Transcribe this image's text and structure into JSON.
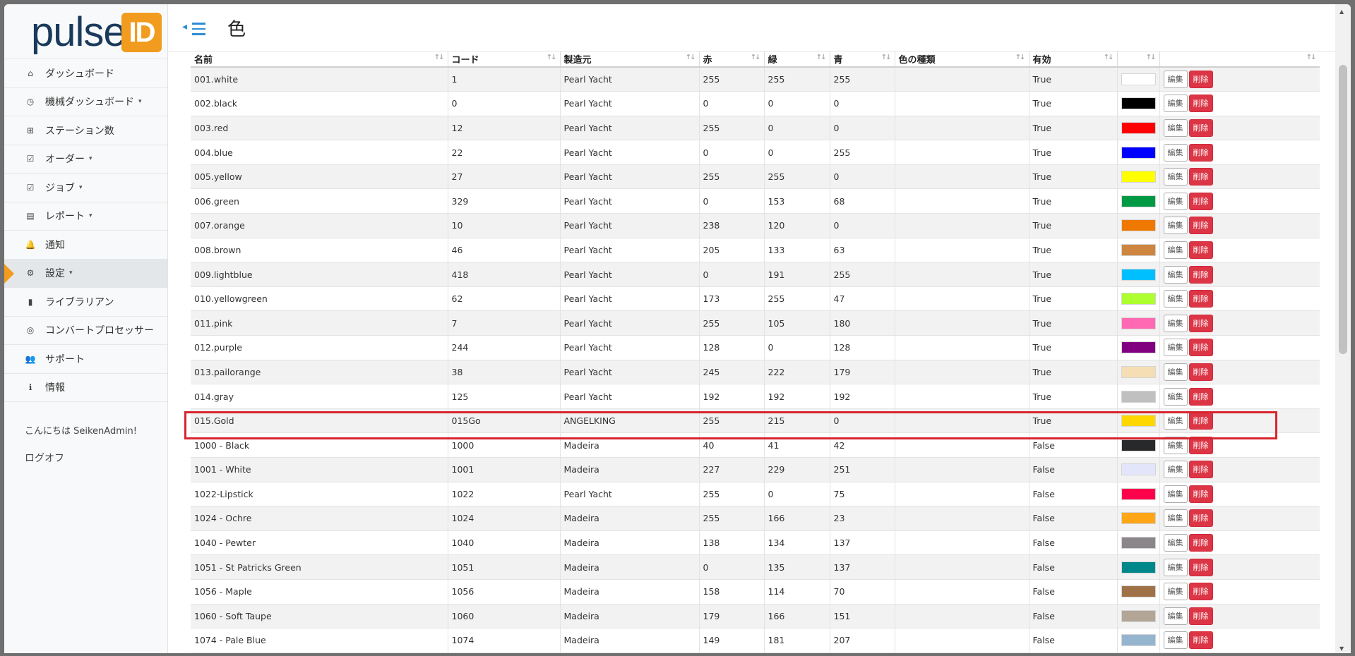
{
  "logo": {
    "text": "pulse",
    "badge": "ID"
  },
  "page": {
    "title": "色"
  },
  "sidebar": {
    "items": [
      {
        "label": "ダッシュボード",
        "icon": "home-icon",
        "glyph": "⌂",
        "caret": ""
      },
      {
        "label": "機械ダッシュボード",
        "icon": "dashboard-icon",
        "glyph": "◷",
        "caret": "▾"
      },
      {
        "label": "ステーション数",
        "icon": "station-icon",
        "glyph": "⊞",
        "caret": ""
      },
      {
        "label": "オーダー",
        "icon": "checkbox-icon",
        "glyph": "☑",
        "caret": "▾"
      },
      {
        "label": "ジョブ",
        "icon": "checkbox-icon",
        "glyph": "☑",
        "caret": "▾"
      },
      {
        "label": "レポート",
        "icon": "report-icon",
        "glyph": "▤",
        "caret": "▾"
      },
      {
        "label": "通知",
        "icon": "bell-icon",
        "glyph": "🔔",
        "caret": ""
      },
      {
        "label": "設定",
        "icon": "gear-icon",
        "glyph": "⚙",
        "caret": "▾"
      },
      {
        "label": "ライブラリアン",
        "icon": "book-icon",
        "glyph": "▮",
        "caret": ""
      },
      {
        "label": "コンバートプロセッサー",
        "icon": "target-icon",
        "glyph": "◎",
        "caret": ""
      },
      {
        "label": "サポート",
        "icon": "users-icon",
        "glyph": "👥",
        "caret": ""
      },
      {
        "label": "情報",
        "icon": "info-icon",
        "glyph": "ℹ",
        "caret": ""
      }
    ],
    "active_index": 7,
    "greeting": "こんにちは SeikenAdmin!",
    "logoff": "ログオフ"
  },
  "table": {
    "headers": [
      "名前",
      "コード",
      "製造元",
      "赤",
      "緑",
      "青",
      "色の種類",
      "有効",
      "",
      ""
    ],
    "sort_icons": [
      "↑↓",
      "↑↓",
      "↑↓",
      "↑↓",
      "↑↓",
      "↑↓",
      "↑↓",
      "↑↓",
      "↑↓",
      "↑↓"
    ],
    "edit_label": "編集",
    "delete_label": "削除",
    "highlighted_row": 14,
    "rows": [
      {
        "name": "001.white",
        "code": "1",
        "maker": "Pearl Yacht",
        "r": "255",
        "g": "255",
        "b": "255",
        "type": "",
        "active": "True",
        "color": "#ffffff"
      },
      {
        "name": "002.black",
        "code": "0",
        "maker": "Pearl Yacht",
        "r": "0",
        "g": "0",
        "b": "0",
        "type": "",
        "active": "True",
        "color": "#000000"
      },
      {
        "name": "003.red",
        "code": "12",
        "maker": "Pearl Yacht",
        "r": "255",
        "g": "0",
        "b": "0",
        "type": "",
        "active": "True",
        "color": "#ff0000"
      },
      {
        "name": "004.blue",
        "code": "22",
        "maker": "Pearl Yacht",
        "r": "0",
        "g": "0",
        "b": "255",
        "type": "",
        "active": "True",
        "color": "#0000ff"
      },
      {
        "name": "005.yellow",
        "code": "27",
        "maker": "Pearl Yacht",
        "r": "255",
        "g": "255",
        "b": "0",
        "type": "",
        "active": "True",
        "color": "#ffff00"
      },
      {
        "name": "006.green",
        "code": "329",
        "maker": "Pearl Yacht",
        "r": "0",
        "g": "153",
        "b": "68",
        "type": "",
        "active": "True",
        "color": "#009944"
      },
      {
        "name": "007.orange",
        "code": "10",
        "maker": "Pearl Yacht",
        "r": "238",
        "g": "120",
        "b": "0",
        "type": "",
        "active": "True",
        "color": "#ee7800"
      },
      {
        "name": "008.brown",
        "code": "46",
        "maker": "Pearl Yacht",
        "r": "205",
        "g": "133",
        "b": "63",
        "type": "",
        "active": "True",
        "color": "#cd853f"
      },
      {
        "name": "009.lightblue",
        "code": "418",
        "maker": "Pearl Yacht",
        "r": "0",
        "g": "191",
        "b": "255",
        "type": "",
        "active": "True",
        "color": "#00bfff"
      },
      {
        "name": "010.yellowgreen",
        "code": "62",
        "maker": "Pearl Yacht",
        "r": "173",
        "g": "255",
        "b": "47",
        "type": "",
        "active": "True",
        "color": "#adff2f"
      },
      {
        "name": "011.pink",
        "code": "7",
        "maker": "Pearl Yacht",
        "r": "255",
        "g": "105",
        "b": "180",
        "type": "",
        "active": "True",
        "color": "#ff69b4"
      },
      {
        "name": "012.purple",
        "code": "244",
        "maker": "Pearl Yacht",
        "r": "128",
        "g": "0",
        "b": "128",
        "type": "",
        "active": "True",
        "color": "#800080"
      },
      {
        "name": "013.pailorange",
        "code": "38",
        "maker": "Pearl Yacht",
        "r": "245",
        "g": "222",
        "b": "179",
        "type": "",
        "active": "True",
        "color": "#f5deb3"
      },
      {
        "name": "014.gray",
        "code": "125",
        "maker": "Pearl Yacht",
        "r": "192",
        "g": "192",
        "b": "192",
        "type": "",
        "active": "True",
        "color": "#c0c0c0"
      },
      {
        "name": "015.Gold",
        "code": "015Go",
        "maker": "ANGELKING",
        "r": "255",
        "g": "215",
        "b": "0",
        "type": "",
        "active": "True",
        "color": "#ffd700"
      },
      {
        "name": "1000 - Black",
        "code": "1000",
        "maker": "Madeira",
        "r": "40",
        "g": "41",
        "b": "42",
        "type": "",
        "active": "False",
        "color": "#28292a"
      },
      {
        "name": "1001 - White",
        "code": "1001",
        "maker": "Madeira",
        "r": "227",
        "g": "229",
        "b": "251",
        "type": "",
        "active": "False",
        "color": "#e3e5fb"
      },
      {
        "name": "1022-Lipstick",
        "code": "1022",
        "maker": "Pearl Yacht",
        "r": "255",
        "g": "0",
        "b": "75",
        "type": "",
        "active": "False",
        "color": "#ff004b"
      },
      {
        "name": "1024 - Ochre",
        "code": "1024",
        "maker": "Madeira",
        "r": "255",
        "g": "166",
        "b": "23",
        "type": "",
        "active": "False",
        "color": "#ffa617"
      },
      {
        "name": "1040 - Pewter",
        "code": "1040",
        "maker": "Madeira",
        "r": "138",
        "g": "134",
        "b": "137",
        "type": "",
        "active": "False",
        "color": "#8a8689"
      },
      {
        "name": "1051 - St Patricks Green",
        "code": "1051",
        "maker": "Madeira",
        "r": "0",
        "g": "135",
        "b": "137",
        "type": "",
        "active": "False",
        "color": "#008789"
      },
      {
        "name": "1056 - Maple",
        "code": "1056",
        "maker": "Madeira",
        "r": "158",
        "g": "114",
        "b": "70",
        "type": "",
        "active": "False",
        "color": "#9e7246"
      },
      {
        "name": "1060 - Soft Taupe",
        "code": "1060",
        "maker": "Madeira",
        "r": "179",
        "g": "166",
        "b": "151",
        "type": "",
        "active": "False",
        "color": "#b3a697"
      },
      {
        "name": "1074 - Pale Blue",
        "code": "1074",
        "maker": "Madeira",
        "r": "149",
        "g": "181",
        "b": "207",
        "type": "",
        "active": "False",
        "color": "#95b5cf"
      }
    ]
  }
}
